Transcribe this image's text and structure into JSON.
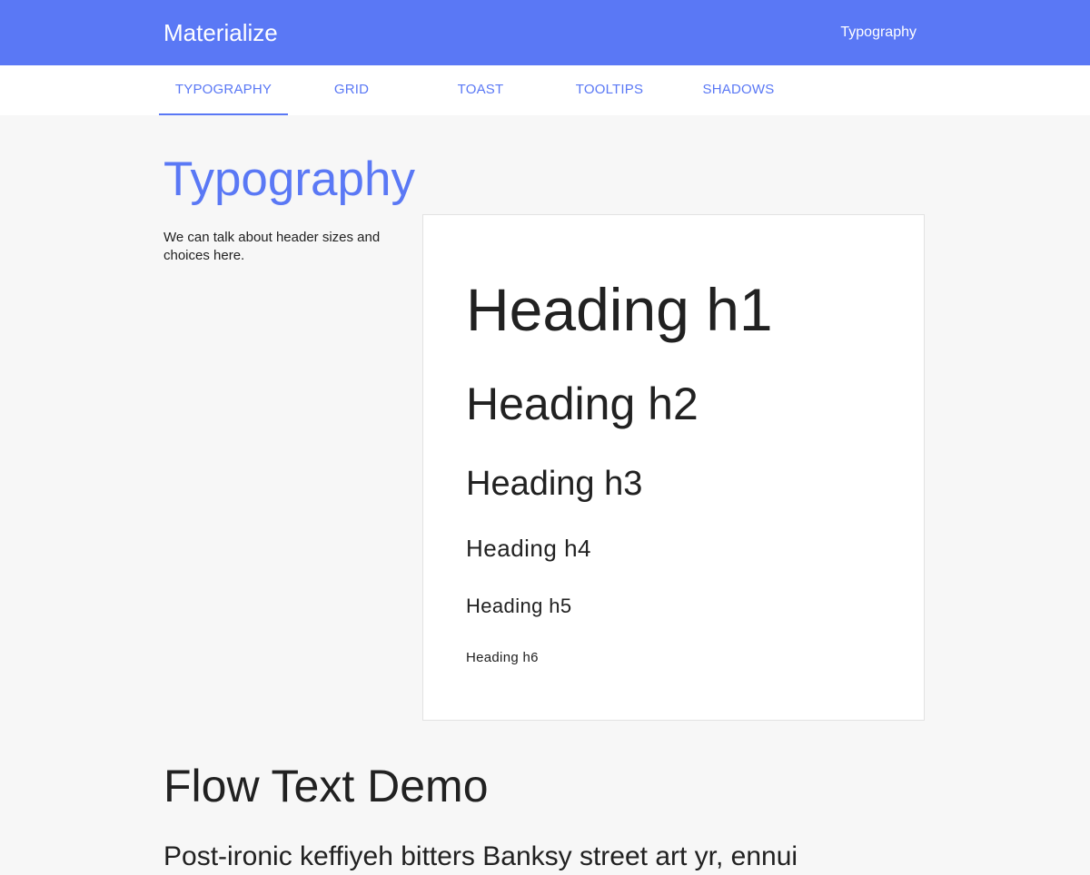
{
  "navbar": {
    "brand": "Materialize",
    "link": "Typography",
    "color": "#5a78f5"
  },
  "tabs": [
    {
      "label": "TYPOGRAPHY",
      "active": true
    },
    {
      "label": "GRID",
      "active": false
    },
    {
      "label": "TOAST",
      "active": false
    },
    {
      "label": "TOOLTIPS",
      "active": false
    },
    {
      "label": "SHADOWS",
      "active": false
    }
  ],
  "typography": {
    "title": "Typography",
    "intro": "We can talk about header sizes and choices here.",
    "headings": {
      "h1": "Heading h1",
      "h2": "Heading h2",
      "h3": "Heading h3",
      "h4": "Heading h4",
      "h5": "Heading h5",
      "h6": "Heading h6"
    }
  },
  "flow_text": {
    "title": "Flow Text Demo",
    "text": "Post-ironic keffiyeh bitters Banksy street art yr, ennui"
  }
}
